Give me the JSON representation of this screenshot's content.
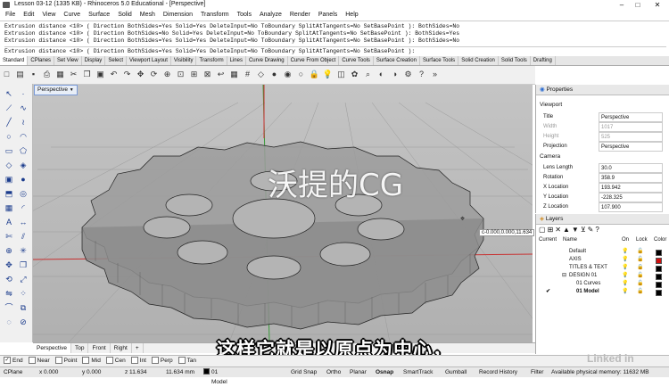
{
  "window": {
    "title": "Lesson 03-12 (1335 KB) - Rhinoceros 5.0 Educational - [Perspective]",
    "minimize": "–",
    "maximize": "□",
    "close": "✕"
  },
  "menu": [
    "File",
    "Edit",
    "View",
    "Curve",
    "Surface",
    "Solid",
    "Mesh",
    "Dimension",
    "Transform",
    "Tools",
    "Analyze",
    "Render",
    "Panels",
    "Help"
  ],
  "command_history": [
    "Extrusion distance <10> ( Direction  BothSides=Yes  Solid=Yes  DeleteInput=No  ToBoundary  SplitAtTangents=No  SetBasePoint ): BothSides=No",
    "Extrusion distance <10> ( Direction  BothSides=No  Solid=Yes  DeleteInput=No  ToBoundary  SplitAtTangents=No  SetBasePoint ): BothSides=Yes",
    "Extrusion distance <10> ( Direction  BothSides=Yes  Solid=Yes  DeleteInput=No  ToBoundary  SplitAtTangents=No  SetBasePoint ): BothSides=No"
  ],
  "command_prompt": "Extrusion distance <10> ( Direction  BothSides=Yes  Solid=Yes  DeleteInput=No  ToBoundary  SplitAtTangents=No  SetBasePoint ):",
  "toolbar_tabs": [
    "Standard",
    "CPlanes",
    "Set View",
    "Display",
    "Select",
    "Viewport Layout",
    "Visibility",
    "Transform",
    "Lines",
    "Curve Drawing",
    "Curve From Object",
    "Curve Tools",
    "Surface Creation",
    "Surface Tools",
    "Solid Creation",
    "Solid Tools",
    "Drafting"
  ],
  "active_tab": "Standard",
  "viewport": {
    "label": "Perspective",
    "dropdown": "▼",
    "coord_tip": "c-0.000,0.000,11.634"
  },
  "viewport_tabs": [
    "Perspective",
    "Top",
    "Front",
    "Right",
    "+"
  ],
  "osnap": [
    {
      "label": "End",
      "checked": true
    },
    {
      "label": "Near",
      "checked": false
    },
    {
      "label": "Point",
      "checked": false
    },
    {
      "label": "Mid",
      "checked": false
    },
    {
      "label": "Cen",
      "checked": false
    },
    {
      "label": "Int",
      "checked": false
    },
    {
      "label": "Perp",
      "checked": false
    },
    {
      "label": "Tan",
      "checked": false
    }
  ],
  "status": {
    "cplane": "CPlane",
    "x": "x 0.000",
    "y": "y 0.000",
    "z": "z 11.634",
    "units": "11.634 mm",
    "layer": "01 Model",
    "grid_snap": "Grid Snap",
    "ortho": "Ortho",
    "planar": "Planar",
    "osnap": "Osnap",
    "smarttrack": "SmartTrack",
    "gumball": "Gumball",
    "record_history": "Record History",
    "filter": "Filter",
    "memory": "Available physical memory: 11632 MB"
  },
  "properties": {
    "title": "Properties",
    "section_viewport": "Viewport",
    "rows": [
      {
        "label": "Title",
        "value": "Perspective",
        "dim": false
      },
      {
        "label": "Width",
        "value": "1017",
        "dim": true
      },
      {
        "label": "Height",
        "value": "525",
        "dim": true
      },
      {
        "label": "Projection",
        "value": "Perspective",
        "dim": false
      }
    ],
    "section_camera": "Camera",
    "camera_rows": [
      {
        "label": "Lens Length",
        "value": "30.0"
      },
      {
        "label": "Rotation",
        "value": "358.9"
      },
      {
        "label": "X Location",
        "value": "193.942"
      },
      {
        "label": "Y Location",
        "value": "-228.325"
      },
      {
        "label": "Z Location",
        "value": "107.900"
      }
    ]
  },
  "layers": {
    "title": "Layers",
    "headers": {
      "current": "Current",
      "name": "Name",
      "on": "On",
      "lock": "Lock",
      "color": "Color"
    },
    "rows": [
      {
        "name": "Default",
        "indent": 0,
        "current": "",
        "color": "#000000"
      },
      {
        "name": "AXIS",
        "indent": 0,
        "current": "",
        "color": "#d01010"
      },
      {
        "name": "TITLES & TEXT",
        "indent": 0,
        "current": "",
        "color": "#000000"
      },
      {
        "name": "DESIGN 01",
        "indent": 0,
        "current": "",
        "expand": "⊟",
        "color": "#000000"
      },
      {
        "name": "01 Curves",
        "indent": 1,
        "current": "",
        "color": "#000000"
      },
      {
        "name": "01 Model",
        "indent": 1,
        "current": "✔",
        "bold": true,
        "color": "#000000"
      }
    ]
  },
  "subtitle": "这样它就是以原点为中心，",
  "overlay_text": "沃提的CG",
  "brand": "Linked in"
}
